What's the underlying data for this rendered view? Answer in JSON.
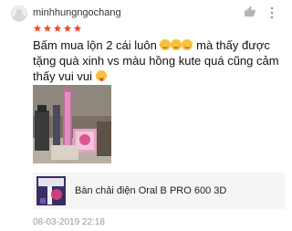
{
  "review": {
    "username": "minhhungngochang",
    "rating": 5,
    "text_part1": "Bấm mua lộn 2 cái luôn",
    "text_part2": "mà thấy được tặng quà xinh vs màu hồng kute quá cũng cảm thấy vui vui",
    "timestamp": "08-03-2019 22:18"
  },
  "product": {
    "name": "Bàn chải điện Oral B PRO 600 3D"
  },
  "colors": {
    "star": "#ee4d2d",
    "accent": "#ee4d2d",
    "product_bg": "#f5f5f5",
    "timestamp": "#9a9a9a"
  },
  "icons": {
    "avatar": "avatar-placeholder",
    "like": "thumbs-up-icon",
    "more": "more-vertical-icon",
    "emoji": "grinning-sweat-emoji"
  }
}
